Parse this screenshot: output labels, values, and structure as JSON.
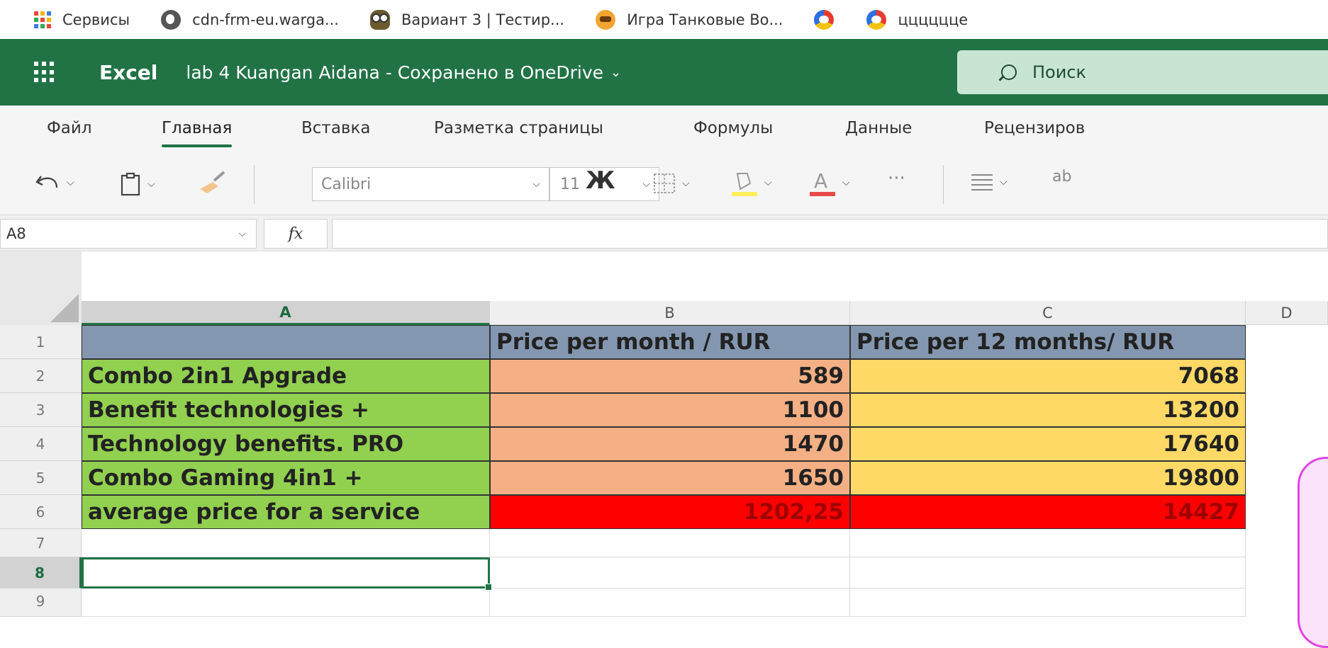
{
  "bookmarks": [
    {
      "icon": "apps-grid-icon",
      "label": "Сервисы"
    },
    {
      "icon": "globe-icon",
      "label": "cdn-frm-eu.warga..."
    },
    {
      "icon": "owl-icon",
      "label": "Вариант 3 | Тестир..."
    },
    {
      "icon": "tank-icon",
      "label": "Игра Танковые Во..."
    },
    {
      "icon": "ring-icon",
      "label": ""
    },
    {
      "icon": "ring-icon",
      "label": "цццццце"
    }
  ],
  "header": {
    "app_name": "Excel",
    "doc_title": "lab 4 Kuangan Aidana  -  Сохранено в OneDrive",
    "doc_chevron": "⌄",
    "search_placeholder": "Поиск"
  },
  "ribbon": {
    "tabs": [
      "Файл",
      "Главная",
      "Вставка",
      "Разметка страницы",
      "Формулы",
      "Данные",
      "Рецензиров"
    ],
    "active_tab": "Главная"
  },
  "toolbar": {
    "font_name": "Calibri",
    "font_size": "11",
    "bold_label": "Ж",
    "more_label": "···",
    "wrap_label": "ab"
  },
  "formula_bar": {
    "name_box": "A8",
    "fx_label": "fx",
    "formula": ""
  },
  "columns": [
    "A",
    "B",
    "C",
    "D"
  ],
  "selected_column": "A",
  "rows": [
    "1",
    "2",
    "3",
    "4",
    "5",
    "6",
    "7",
    "8",
    "9"
  ],
  "selected_row": "8",
  "sheet": {
    "header": [
      "",
      "Price per month / RUR",
      "Price per 12 months/ RUR"
    ],
    "data": [
      [
        "Combo 2in1 Apgrade",
        "589",
        "7068"
      ],
      [
        "Benefit technologies +",
        "1100",
        "13200"
      ],
      [
        "Technology benefits. PRO",
        "1470",
        "17640"
      ],
      [
        "Combo Gaming 4in1 +",
        "1650",
        "19800"
      ],
      [
        "average price for a service",
        "1202,25",
        "14427"
      ]
    ]
  },
  "colors": {
    "excel_green": "#217346",
    "header_fill": "#8497b0",
    "label_fill": "#92d050",
    "month_fill": "#f4b084",
    "year_fill": "#ffd966",
    "avg_fill": "#ff0000"
  }
}
